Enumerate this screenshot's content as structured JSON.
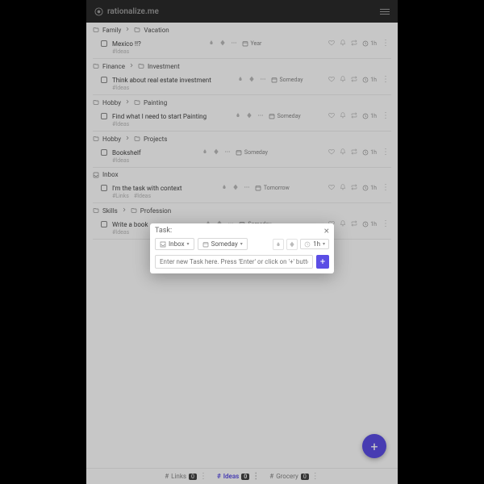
{
  "brand": "rationalize.me",
  "groups": [
    {
      "crumbs": [
        "Family",
        "Vacation"
      ],
      "tasks": [
        {
          "title": "Mexico !!?",
          "date": "Year",
          "est": "1h",
          "subs": [
            "#Ideas"
          ]
        }
      ]
    },
    {
      "crumbs": [
        "Finance",
        "Investment"
      ],
      "tasks": [
        {
          "title": "Think about real estate investment",
          "date": "Someday",
          "est": "1h",
          "subs": [
            "#Ideas"
          ]
        }
      ]
    },
    {
      "crumbs": [
        "Hobby",
        "Painting"
      ],
      "tasks": [
        {
          "title": "Find what I need to start Painting",
          "date": "Someday",
          "est": "1h",
          "subs": [
            "#Ideas"
          ]
        }
      ]
    },
    {
      "crumbs": [
        "Hobby",
        "Projects"
      ],
      "tasks": [
        {
          "title": "Bookshelf",
          "date": "Someday",
          "est": "1h",
          "subs": [
            "#Ideas"
          ]
        }
      ]
    },
    {
      "crumbs": [
        "Inbox"
      ],
      "tasks": [
        {
          "title": "I'm the task with context",
          "date": "Tomorrow",
          "est": "1h",
          "subs": [
            "#Links",
            "#Ideas"
          ]
        }
      ]
    },
    {
      "crumbs": [
        "Skills",
        "Profession"
      ],
      "tasks": [
        {
          "title": "Write a book",
          "date": "Someday",
          "est": "1h",
          "subs": [
            "#Ideas"
          ]
        }
      ]
    }
  ],
  "footer": {
    "tags": [
      {
        "label": "Links",
        "count": "0",
        "active": false
      },
      {
        "label": "Ideas",
        "count": "0",
        "active": true
      },
      {
        "label": "Grocery",
        "count": "0",
        "active": false
      }
    ]
  },
  "modal": {
    "title": "Task:",
    "list_dd": "Inbox",
    "date_dd": "Someday",
    "est_dd": "1h",
    "placeholder": "Enter new Task here. Press 'Enter' or click on '+' button."
  }
}
